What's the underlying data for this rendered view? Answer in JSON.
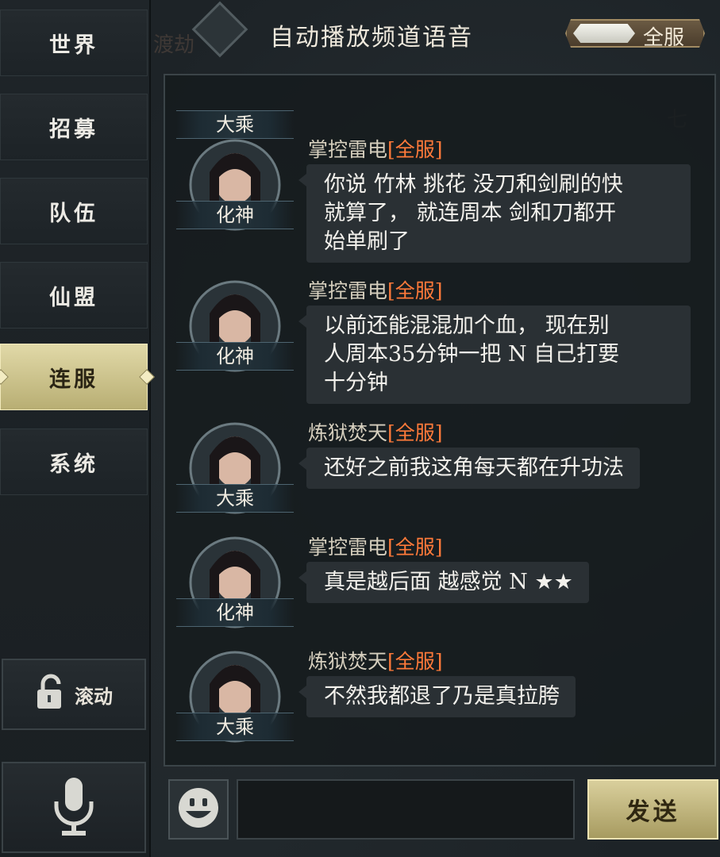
{
  "header": {
    "title": "自动播放频道语音",
    "server_toggle_label": "全服"
  },
  "sidebar": {
    "tabs": [
      {
        "label": "世界",
        "active": false
      },
      {
        "label": "招募",
        "active": false
      },
      {
        "label": "队伍",
        "active": false
      },
      {
        "label": "仙盟",
        "active": false
      },
      {
        "label": "连服",
        "active": true
      },
      {
        "label": "系统",
        "active": false
      }
    ],
    "scroll_label": "滚动"
  },
  "chat": {
    "top_partial_rank": "大乘",
    "messages": [
      {
        "sender": "掌控雷电",
        "tag": "[全服]",
        "rank": "化神",
        "lines": [
          "你说 竹林 挑花 没刀和剑刷的快",
          "就算了， 就连周本 剑和刀都开",
          "始单刷了"
        ]
      },
      {
        "sender": "掌控雷电",
        "tag": "[全服]",
        "rank": "化神",
        "lines": [
          "以前还能混混加个血， 现在别",
          "人周本35分钟一把 N 自己打要",
          "十分钟"
        ]
      },
      {
        "sender": "炼狱焚天",
        "tag": "[全服]",
        "rank": "大乘",
        "lines": [
          "还好之前我这角每天都在升功法"
        ]
      },
      {
        "sender": "掌控雷电",
        "tag": "[全服]",
        "rank": "化神",
        "lines": [
          "真是越后面 越感觉 N ★★"
        ]
      },
      {
        "sender": "炼狱焚天",
        "tag": "[全服]",
        "rank": "大乘",
        "lines": [
          "不然我都退了乃是真拉胯"
        ]
      }
    ]
  },
  "input": {
    "value": "",
    "send_label": "发送"
  },
  "colors": {
    "tag": "#ff7a3a",
    "active_tab": "#d8cf9c",
    "bubble": "#2a3034"
  }
}
